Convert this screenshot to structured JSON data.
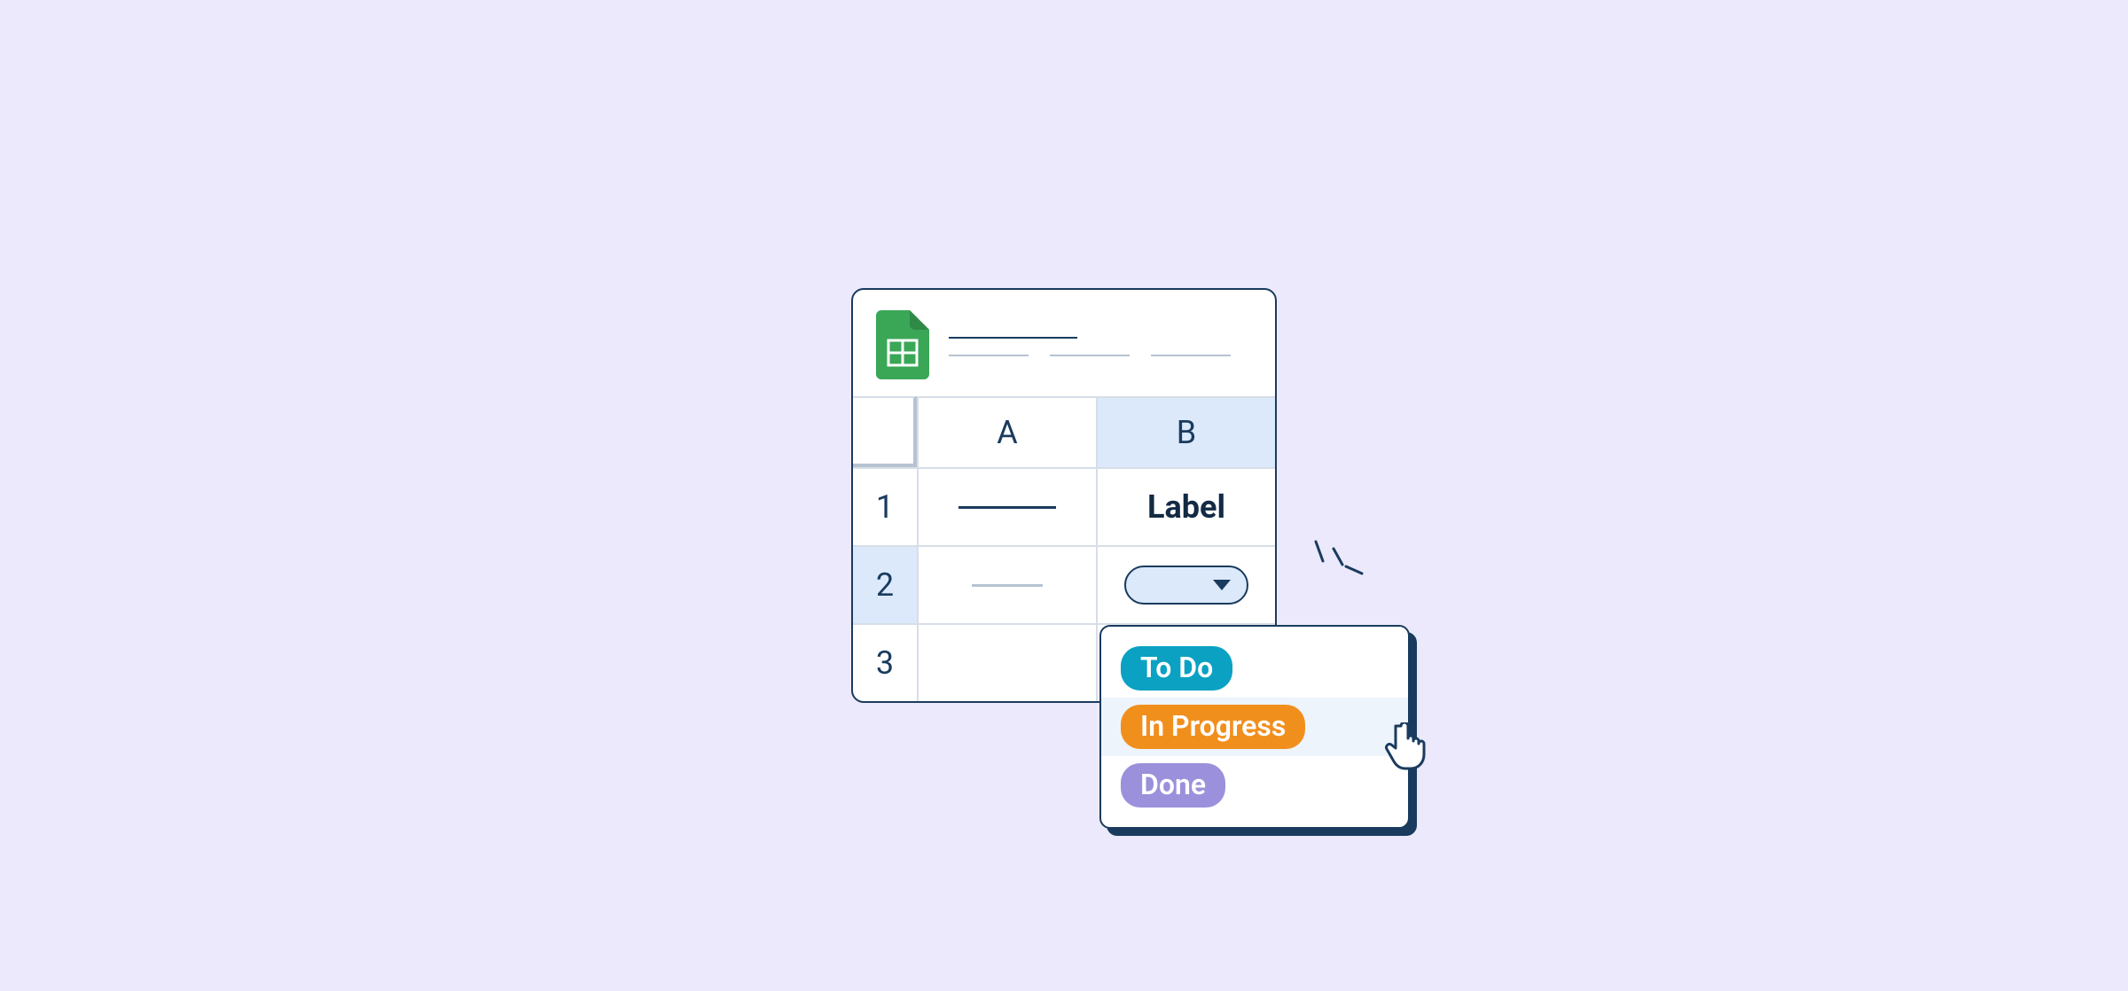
{
  "sheet": {
    "columns": {
      "a": "A",
      "b": "B"
    },
    "rows": {
      "r1": "1",
      "r2": "2",
      "r3": "3"
    },
    "b1_label": "Label"
  },
  "dropdown": {
    "options": {
      "todo": "To Do",
      "in_progress": "In Progress",
      "done": "Done"
    },
    "hovered": "in_progress"
  },
  "colors": {
    "todo": "#0aa1c3",
    "in_progress": "#f18f1d",
    "done": "#9b90db",
    "navy": "#1a3b5e",
    "highlight": "#dbe9fb"
  }
}
